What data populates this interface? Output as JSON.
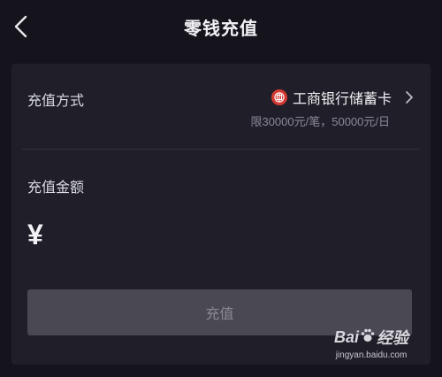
{
  "header": {
    "title": "零钱充值"
  },
  "payment_method": {
    "label": "充值方式",
    "bank_name": "工商银行储蓄卡",
    "limit": "限30000元/笔，50000元/日"
  },
  "amount": {
    "label": "充值金额",
    "currency_symbol": "¥"
  },
  "submit": {
    "label": "充值"
  },
  "watermark": {
    "brand_left": "Bai",
    "brand_right": "经验",
    "url": "jingyan.baidu.com"
  },
  "colors": {
    "background": "#15141c",
    "card": "#201f29",
    "bank_logo": "#d43a32",
    "button_disabled": "#4a4852"
  },
  "icons": [
    "back-arrow-icon",
    "icbc-logo-icon",
    "chevron-right-icon",
    "paw-icon"
  ]
}
